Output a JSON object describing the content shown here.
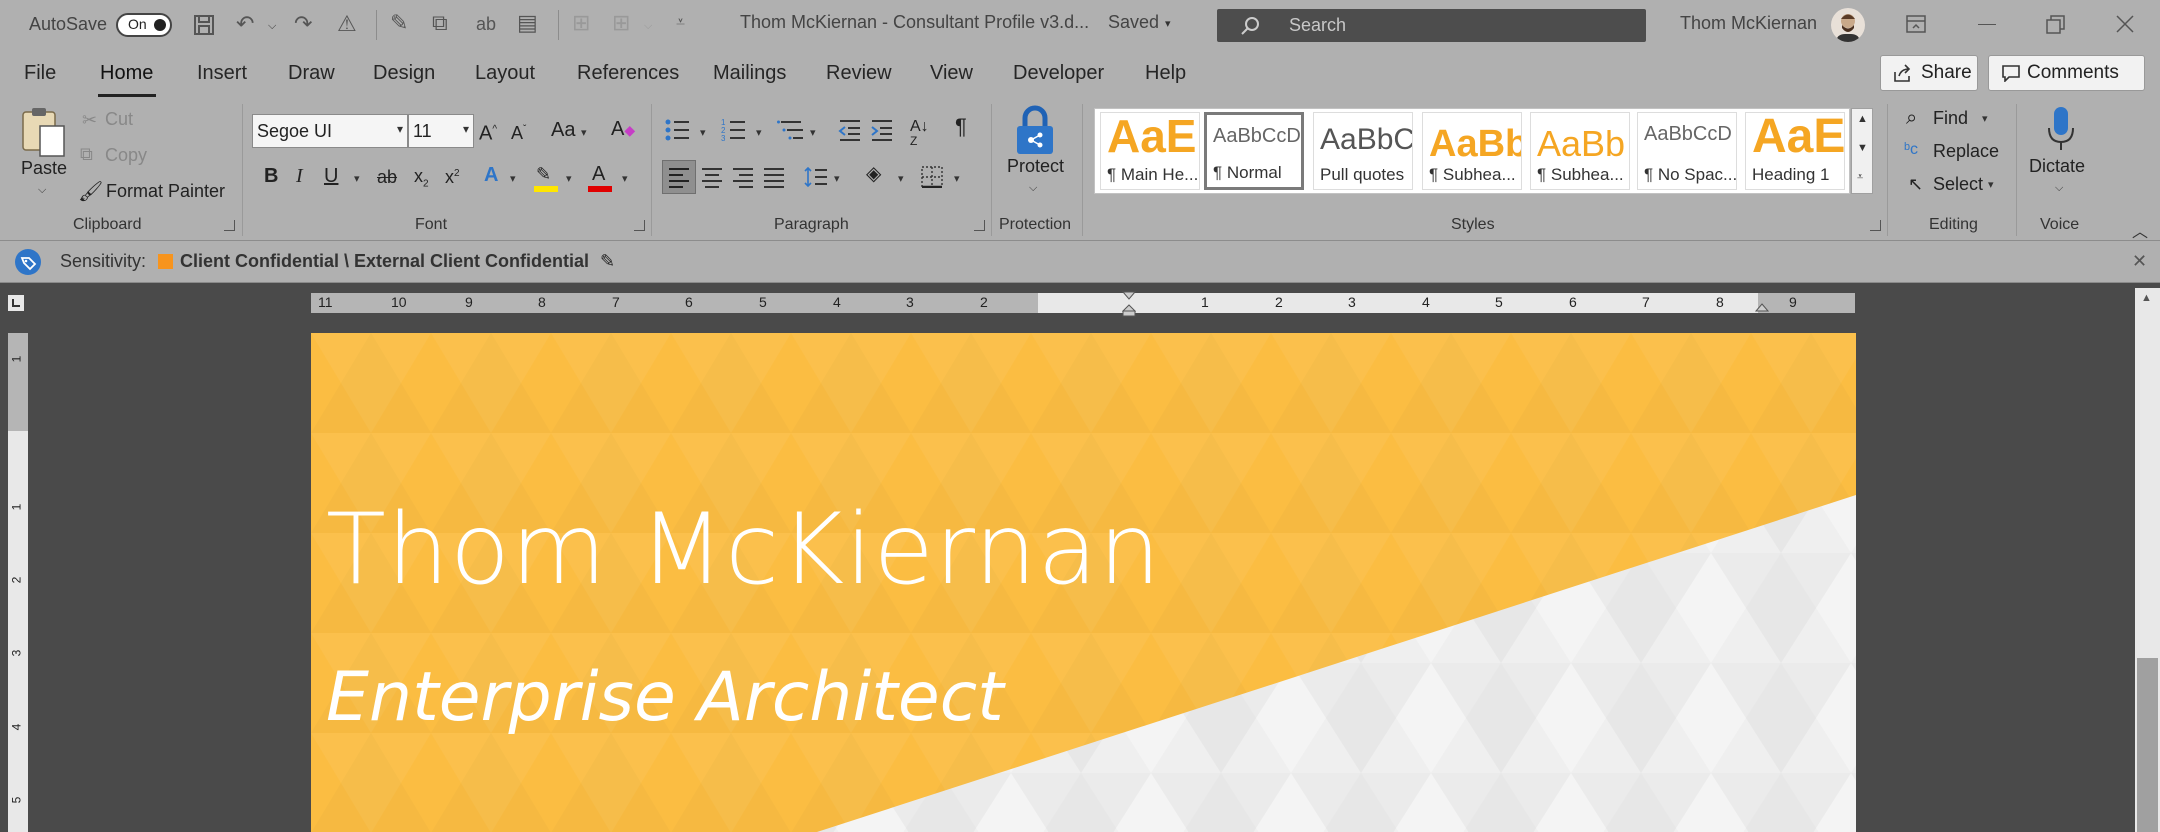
{
  "title_bar": {
    "autosave_label": "AutoSave",
    "autosave_state": "On",
    "document_title": "Thom McKiernan - Consultant Profile v3.d...",
    "save_status": "Saved",
    "search_placeholder": "Search",
    "user_name": "Thom McKiernan"
  },
  "menu_tabs": [
    "File",
    "Home",
    "Insert",
    "Draw",
    "Design",
    "Layout",
    "References",
    "Mailings",
    "Review",
    "View",
    "Developer",
    "Help"
  ],
  "active_tab": "Home",
  "header_buttons": {
    "share": "Share",
    "comments": "Comments"
  },
  "clipboard": {
    "paste": "Paste",
    "cut": "Cut",
    "copy": "Copy",
    "format_painter": "Format Painter",
    "label": "Clipboard"
  },
  "font": {
    "family": "Segoe UI",
    "size": "11",
    "label": "Font",
    "change_case": "Aa"
  },
  "paragraph": {
    "label": "Paragraph"
  },
  "protection": {
    "protect": "Protect",
    "label": "Protection"
  },
  "styles": {
    "label": "Styles",
    "tiles": [
      {
        "preview": "AaE",
        "name": "¶ Main He...",
        "color": "#f5a623"
      },
      {
        "preview": "AaBbCcD",
        "name": "¶ Normal",
        "color": "#666666"
      },
      {
        "preview": "AaBbC",
        "name": "Pull quotes",
        "color": "#555555"
      },
      {
        "preview": "AaBb",
        "name": "¶ Subhea...",
        "color": "#f5a623"
      },
      {
        "preview": "AaBb",
        "name": "¶ Subhea...",
        "color": "#f5a623"
      },
      {
        "preview": "AaBbCcD",
        "name": "¶ No Spac...",
        "color": "#666666"
      },
      {
        "preview": "AaE",
        "name": "Heading 1",
        "color": "#f5a623"
      }
    ]
  },
  "editing": {
    "find": "Find",
    "replace": "Replace",
    "select": "Select",
    "label": "Editing"
  },
  "voice": {
    "dictate": "Dictate",
    "label": "Voice"
  },
  "sensitivity": {
    "label": "Sensitivity:",
    "value": "Client Confidential \\ External Client Confidential",
    "badge_color": "#f7941d"
  },
  "ruler_numbers": [
    "11",
    "10",
    "9",
    "8",
    "7",
    "6",
    "5",
    "4",
    "3",
    "2",
    "1",
    "2",
    "3",
    "4",
    "5",
    "6",
    "7",
    "8",
    "9"
  ],
  "vertical_ruler_numbers": [
    "1",
    "1",
    "2",
    "3",
    "4",
    "5"
  ],
  "document": {
    "name": "Thom McKiernan",
    "title": "Enterprise Architect",
    "banner_color": "#fbbd42"
  }
}
